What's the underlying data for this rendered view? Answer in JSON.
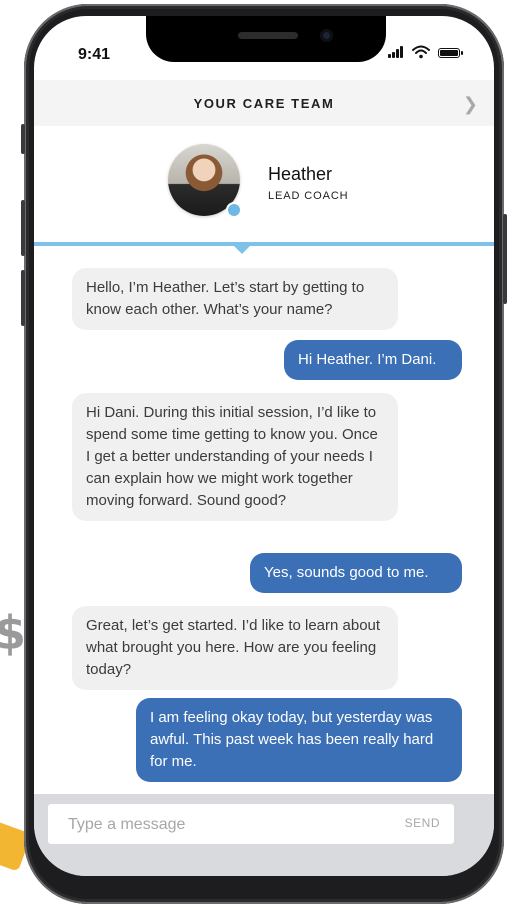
{
  "status_bar": {
    "time": "9:41"
  },
  "header": {
    "title": "YOUR CARE TEAM"
  },
  "coach": {
    "name": "Heather",
    "role": "LEAD COACH"
  },
  "messages": [
    {
      "from": "coach",
      "text": "Hello, I’m Heather. Let’s start by getting to know each other. What’s your name?"
    },
    {
      "from": "user",
      "text": "Hi Heather. I’m Dani."
    },
    {
      "from": "coach",
      "text": "Hi Dani. During this initial session, I’d like to spend some time getting to know you. Once I get a better understanding of your needs I can explain how we might work together moving forward. Sound good?"
    },
    {
      "from": "user",
      "text": "Yes, sounds good to me."
    },
    {
      "from": "coach",
      "text": "Great, let’s get started. I’d like to learn about what brought you here. How are you feeling today?"
    },
    {
      "from": "user",
      "text": "I am feeling okay today, but yesterday was awful. This past week has been really hard for me."
    }
  ],
  "composer": {
    "placeholder": "Type a message",
    "send_label": "SEND"
  },
  "colors": {
    "user_bubble": "#3b6fb6",
    "coach_bubble": "#f0f0f0",
    "accent": "#7fc1e8"
  },
  "icons": [
    "signal-icon",
    "wifi-icon",
    "battery-icon",
    "chevron-right-icon",
    "online-status-icon"
  ]
}
